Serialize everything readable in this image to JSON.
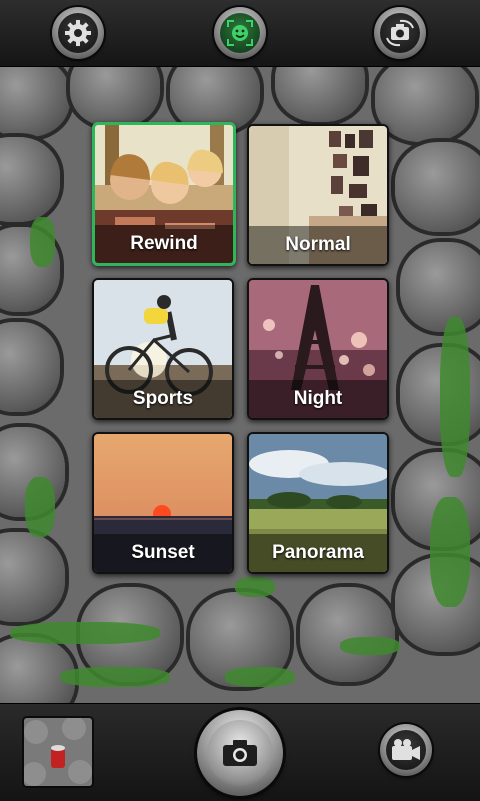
{
  "top_bar": {
    "settings_icon": "gear-icon",
    "mode_icon": "face-detect-icon",
    "switch_camera_icon": "camera-switch-icon"
  },
  "modes": [
    {
      "label": "Rewind",
      "selected": true
    },
    {
      "label": "Normal",
      "selected": false
    },
    {
      "label": "Sports",
      "selected": false
    },
    {
      "label": "Night",
      "selected": false
    },
    {
      "label": "Sunset",
      "selected": false
    },
    {
      "label": "Panorama",
      "selected": false
    }
  ],
  "bottom_bar": {
    "gallery_thumb_icon": "gallery-thumbnail",
    "shutter_icon": "camera-icon",
    "video_icon": "video-camera-icon"
  },
  "colors": {
    "selected_border": "#2fb55a",
    "mode_icon_green": "#3fd06a"
  }
}
